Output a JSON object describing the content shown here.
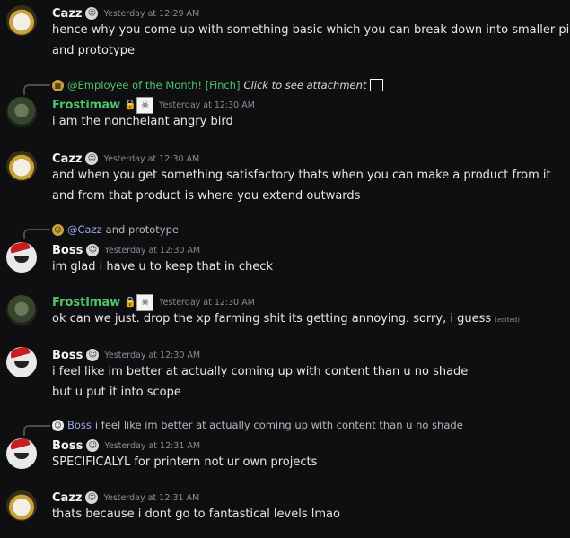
{
  "messages": [
    {
      "user": "Cazz",
      "time": "Yesterday at 12:29 AM",
      "lines": [
        "hence why you come up with something basic which you can break down into smaller pieces",
        "and prototype"
      ]
    },
    {
      "reply": {
        "mention": "@Employee of the Month! [Finch]",
        "text": "Click to see attachment"
      },
      "user": "Frostimaw",
      "time": "Yesterday at 12:30 AM",
      "lines": [
        "i am the nonchelant angry bird"
      ]
    },
    {
      "user": "Cazz",
      "time": "Yesterday at 12:30 AM",
      "lines": [
        "and when you get something satisfactory thats when you can make a product from it",
        "and from that product is where you extend outwards"
      ]
    },
    {
      "reply": {
        "mention": "@Cazz",
        "text": "and prototype"
      },
      "user": "Boss",
      "time": "Yesterday at 12:30 AM",
      "lines": [
        "im glad i have u to keep that in check"
      ]
    },
    {
      "user": "Frostimaw",
      "time": "Yesterday at 12:30 AM",
      "lines": [
        "ok can we just. drop the xp farming shit its getting annoying. sorry, i guess"
      ],
      "edited": "(edited)"
    },
    {
      "user": "Boss",
      "time": "Yesterday at 12:30 AM",
      "lines": [
        "i feel like im better at actually coming up with content than u no shade",
        "but u put it into scope"
      ]
    },
    {
      "reply": {
        "mention": "Boss",
        "text": "i feel like im better at actually coming up with content than u no shade"
      },
      "user": "Boss",
      "time": "Yesterday at 12:31 AM",
      "lines": [
        "SPECIFICALYL for printern not ur own projects"
      ]
    },
    {
      "user": "Cazz",
      "time": "Yesterday at 12:31 AM",
      "lines": [
        "thats because i dont go to fantastical levels lmao"
      ]
    }
  ]
}
